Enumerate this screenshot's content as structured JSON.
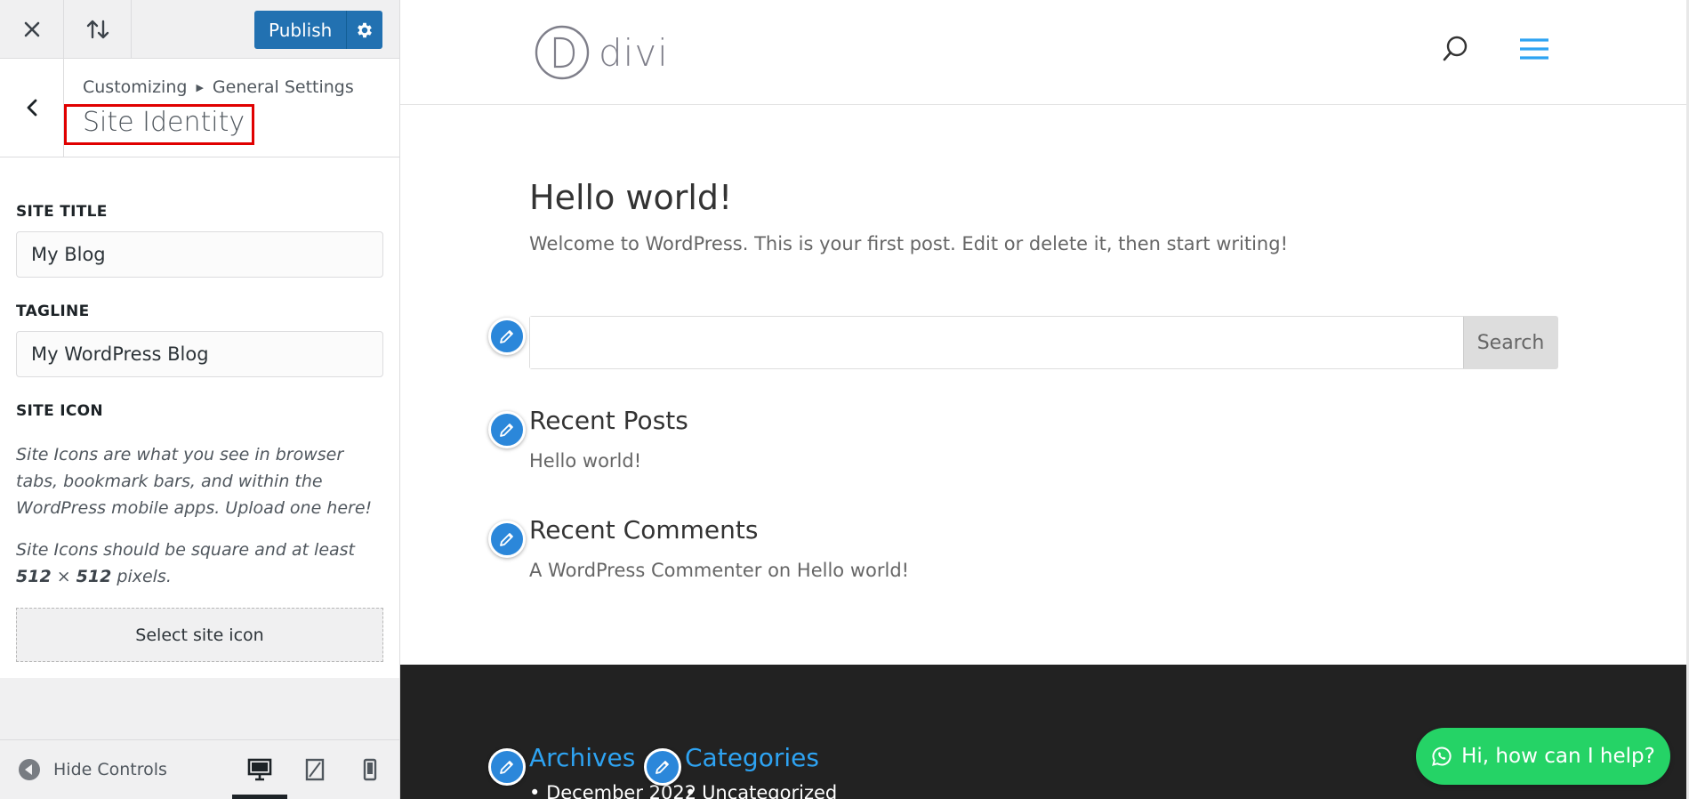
{
  "topbar": {
    "publish_label": "Publish"
  },
  "section": {
    "breadcrumb_root": "Customizing",
    "breadcrumb_parent": "General Settings",
    "title": "Site Identity"
  },
  "controls": {
    "site_title_label": "SITE TITLE",
    "site_title_value": "My Blog",
    "tagline_label": "TAGLINE",
    "tagline_value": "My WordPress Blog",
    "site_icon_label": "SITE ICON",
    "site_icon_desc": "Site Icons are what you see in browser tabs, bookmark bars, and within the WordPress mobile apps. Upload one here!",
    "site_icon_size_prefix": "Site Icons should be square and at least ",
    "site_icon_size_w": "512",
    "site_icon_size_times": " × ",
    "site_icon_size_h": "512",
    "site_icon_size_suffix": " pixels.",
    "select_icon_label": "Select site icon"
  },
  "footer_bar": {
    "hide_controls_label": "Hide Controls"
  },
  "preview": {
    "logo_text": "divi",
    "post_title": "Hello world!",
    "post_excerpt": "Welcome to WordPress. This is your first post. Edit or delete it, then start writing!",
    "search_button": "Search",
    "recent_posts_title": "Recent Posts",
    "recent_posts_item": "Hello world!",
    "recent_comments_title": "Recent Comments",
    "recent_comments_author": "A WordPress Commenter",
    "recent_comments_on": " on ",
    "recent_comments_post": "Hello world!",
    "archives_title": "Archives",
    "archives_item": "December 2022",
    "categories_title": "Categories",
    "categories_item": "Uncategorized",
    "chat_label": "Hi, how can I help?"
  },
  "colors": {
    "publish_blue": "#2271b1",
    "highlight_red": "#e00000",
    "divi_blue": "#2ea3f2",
    "edit_pencil_blue": "#2b87da",
    "footer_dark": "#222222",
    "whatsapp_green": "#25d366"
  }
}
